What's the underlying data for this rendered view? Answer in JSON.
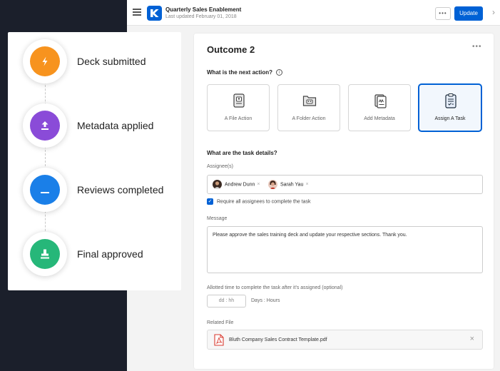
{
  "app": {
    "doc_title": "Quarterly Sales Enablement",
    "doc_subtitle": "Last updated February 01, 2018",
    "more_label": "•••",
    "update_label": "Update",
    "accent_color": "#0061d5"
  },
  "card": {
    "title": "Outcome 2",
    "more_label": "•••",
    "next_action_question": "What is the next action?",
    "info_icon": "i",
    "actions": [
      {
        "label": "A File Action",
        "icon": "file-icon",
        "selected": false
      },
      {
        "label": "A Folder Action",
        "icon": "folder-icon",
        "selected": false
      },
      {
        "label": "Add Metadata",
        "icon": "metadata-icon",
        "selected": false
      },
      {
        "label": "Assign A Task",
        "icon": "clipboard-icon",
        "selected": true
      }
    ],
    "task_details_heading": "What are the task details?",
    "assignees_label": "Assignee(s)",
    "assignees": [
      {
        "name": "Andrew Dunn",
        "remove": "×"
      },
      {
        "name": "Sarah Yau",
        "remove": "×"
      }
    ],
    "require_all_label": "Require all assignees to complete the task",
    "require_all_checked": true,
    "message_label": "Message",
    "message_value": "Please approve the sales training deck and update your respective sections. Thank you.",
    "allotted_label": "Allotted time to complete the task after it's assigned (optional)",
    "time_placeholder": "dd : hh",
    "time_units": "Days : Hours",
    "related_label": "Related File",
    "related_file": "Bluth Company Sales Contract Template.pdf",
    "related_remove": "×"
  },
  "timeline": {
    "steps": [
      {
        "label": "Deck submitted",
        "color": "#f7931e",
        "icon": "lightning-icon"
      },
      {
        "label": "Metadata applied",
        "color": "#8a4bd8",
        "icon": "upload-icon"
      },
      {
        "label": "Reviews completed",
        "color": "#1a7fe8",
        "icon": "minus-icon"
      },
      {
        "label": "Final approved",
        "color": "#26b779",
        "icon": "stamp-icon"
      }
    ]
  }
}
